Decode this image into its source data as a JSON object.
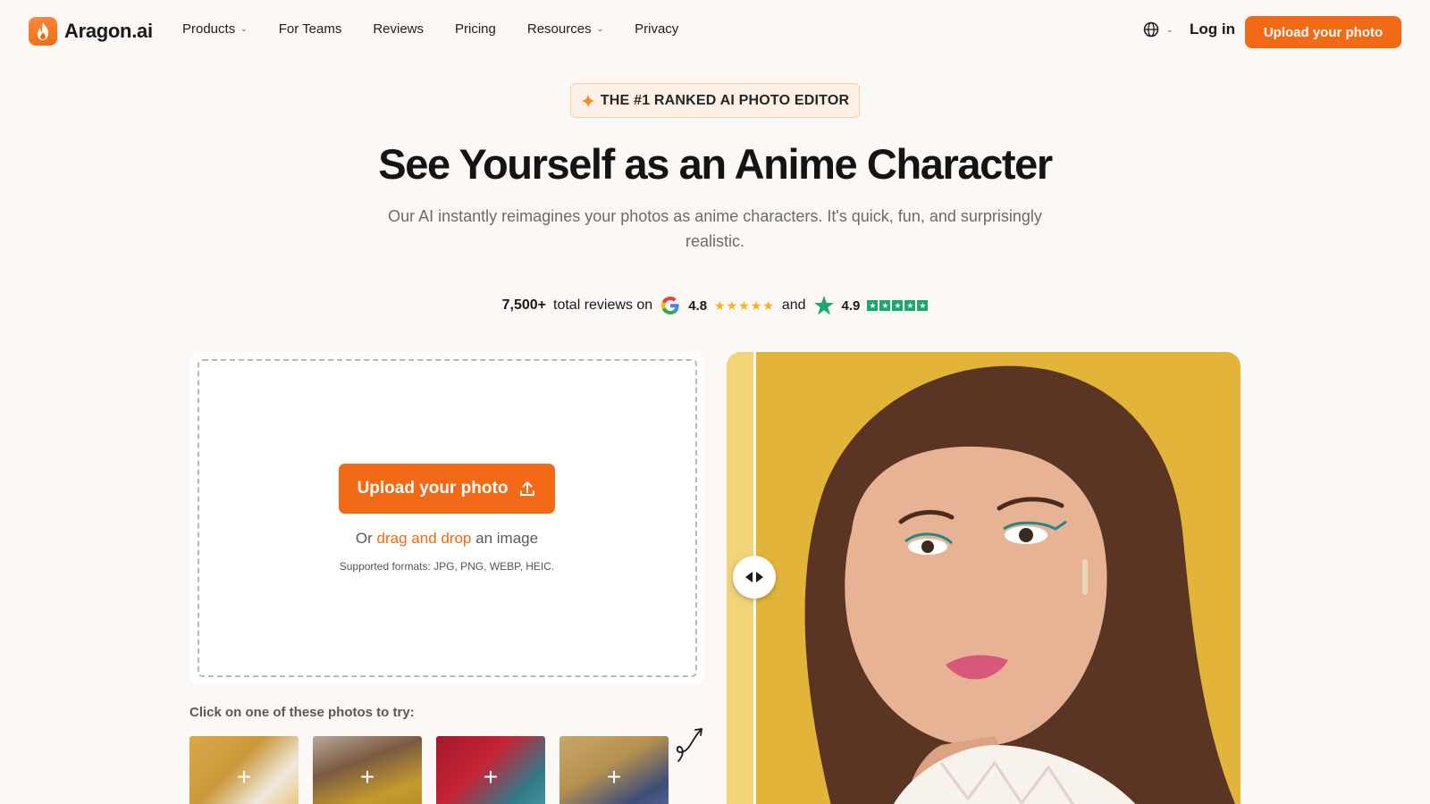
{
  "header": {
    "brand": "Aragon.ai",
    "nav": [
      {
        "label": "Products",
        "has_dropdown": true
      },
      {
        "label": "For Teams",
        "has_dropdown": false
      },
      {
        "label": "Reviews",
        "has_dropdown": false
      },
      {
        "label": "Pricing",
        "has_dropdown": false
      },
      {
        "label": "Resources",
        "has_dropdown": true
      },
      {
        "label": "Privacy",
        "has_dropdown": false
      }
    ],
    "login": "Log in",
    "cta": "Upload your photo"
  },
  "hero": {
    "badge": "THE #1 RANKED AI PHOTO EDITOR",
    "title": "See Yourself as an Anime Character",
    "subtitle": "Our AI instantly reimagines your photos as anime characters. It's quick, fun, and surprisingly realistic."
  },
  "reviews": {
    "count": "7,500+",
    "text": "total reviews on",
    "google_rating": "4.8",
    "and": "and",
    "trustpilot_rating": "4.9"
  },
  "upload": {
    "button": "Upload your photo",
    "drag_prefix": "Or",
    "drag_link": "drag and drop",
    "drag_suffix": "an image",
    "formats": "Supported formats: JPG, PNG, WEBP, HEIC."
  },
  "samples": {
    "label": "Click on one of these photos to try:",
    "count": 4
  },
  "colors": {
    "accent": "#f26a16",
    "background": "#fbf8f6",
    "preview_bg": "#e2b53a",
    "trustpilot": "#1ea672",
    "google_star": "#f6b21a"
  }
}
